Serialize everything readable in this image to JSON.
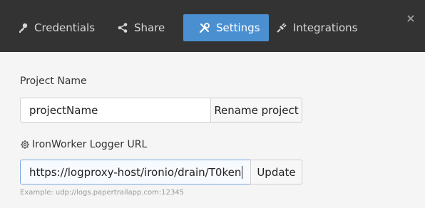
{
  "tabs": [
    {
      "label": "Credentials",
      "icon": "key-icon",
      "active": false
    },
    {
      "label": "Share",
      "icon": "share-icon",
      "active": false
    },
    {
      "label": "Settings",
      "icon": "tools-icon",
      "active": true
    },
    {
      "label": "Integrations",
      "icon": "plug-icon",
      "active": false
    }
  ],
  "close_glyph": "×",
  "project": {
    "label": "Project Name",
    "value": "projectName",
    "rename_label": "Rename project"
  },
  "logger": {
    "label": "IronWorker Logger URL",
    "value": "https://logproxy-host/ironio/drain/T0ken",
    "update_label": "Update",
    "example": "Example: udp://logs.papertrailapp.com:12345"
  },
  "colors": {
    "header_bg": "#333333",
    "active_tab": "#4a90d1",
    "page_bg": "#f5f5f5"
  }
}
